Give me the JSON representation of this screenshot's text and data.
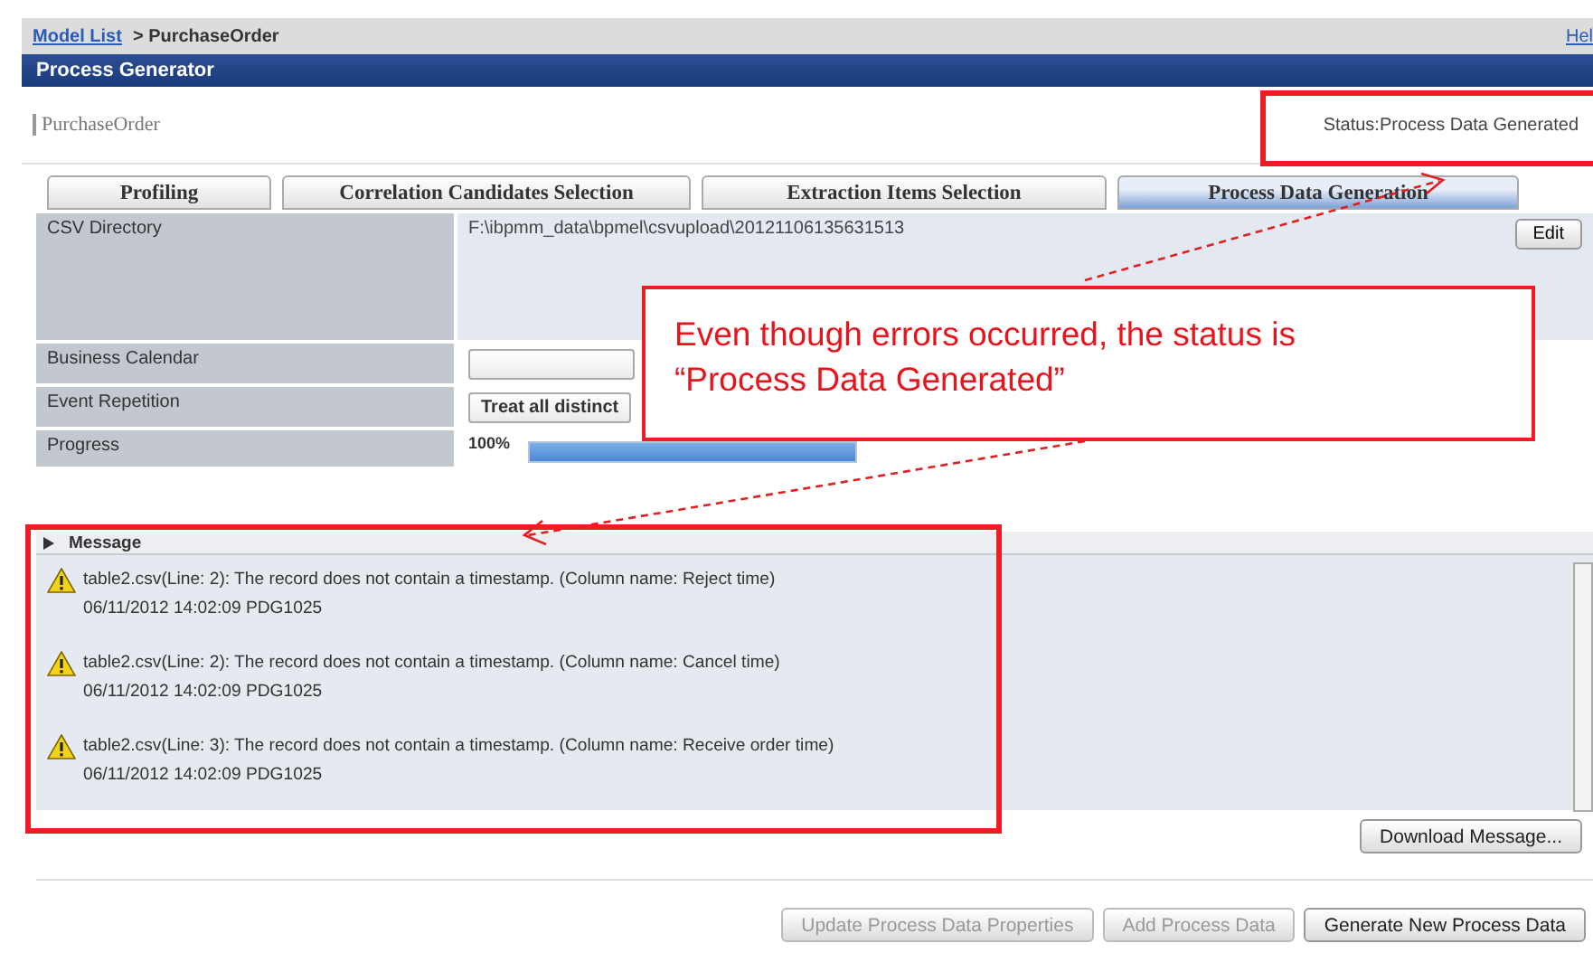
{
  "breadcrumb": {
    "link": "Model List",
    "current": "> PurchaseOrder",
    "help": "Hel"
  },
  "title": "Process Generator",
  "model_name": "PurchaseOrder",
  "status": "Status:Process Data Generated",
  "tabs": [
    {
      "label": "Profiling",
      "selected": false
    },
    {
      "label": "Correlation Candidates Selection",
      "selected": false
    },
    {
      "label": "Extraction Items Selection",
      "selected": false
    },
    {
      "label": "Process Data Generation",
      "selected": true
    }
  ],
  "properties": [
    {
      "kind": "text",
      "label": "CSV Directory",
      "value": "F:\\ibpmm_data\\bpmel\\csvupload\\20121106135631513",
      "button": "Edit"
    },
    {
      "kind": "select",
      "label": "Business Calendar"
    },
    {
      "kind": "select",
      "label": "Event Repetition",
      "value": "Treat all distinct"
    },
    {
      "kind": "progress",
      "label": "Progress",
      "value": "100%",
      "level": 1
    }
  ],
  "message_panel": {
    "title": "Message",
    "messages": [
      {
        "text": "table2.csv(Line: 2): The record does not contain a timestamp. (Column name: Reject time)",
        "meta": "06/11/2012 14:02:09 PDG1025"
      },
      {
        "text": "table2.csv(Line: 2): The record does not contain a timestamp. (Column name: Cancel time)",
        "meta": "06/11/2012 14:02:09 PDG1025"
      },
      {
        "text": "table2.csv(Line: 3): The record does not contain a timestamp. (Column name: Receive order time)",
        "meta": "06/11/2012 14:02:09 PDG1025"
      }
    ],
    "download": "Download Message..."
  },
  "buttons": [
    {
      "label": "Update Process Data Properties",
      "disabled": true
    },
    {
      "label": "Add Process Data",
      "disabled": true
    },
    {
      "label": "Generate New Process Data",
      "disabled": false
    }
  ],
  "annotation": {
    "text": "Even though errors occurred, the status is “Process Data Generated”"
  }
}
